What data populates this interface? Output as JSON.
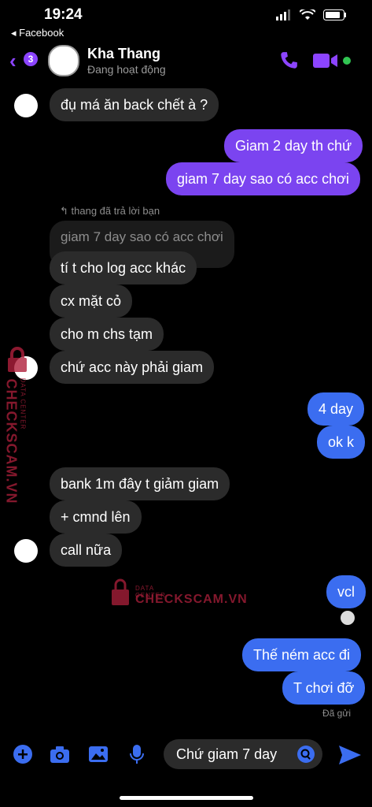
{
  "status_bar": {
    "time": "19:24",
    "back_app": "◂ Facebook"
  },
  "header": {
    "unread_count": "3",
    "contact_name": "Kha Thang",
    "contact_status": "Đang hoạt động"
  },
  "messages": [
    {
      "side": "in",
      "text": "đụ má ăn back chết  à ?"
    },
    {
      "side": "out",
      "text": "Giam 2 day th chứ"
    },
    {
      "side": "out",
      "text": "giam 7 day sao có acc chơi"
    },
    {
      "side": "in",
      "reply_label": "thang đã trả lời bạn",
      "quote": "giam 7 day sao có acc chơi"
    },
    {
      "side": "in",
      "text": "tí t cho log acc khác"
    },
    {
      "side": "in",
      "text": "cx mặt cỏ"
    },
    {
      "side": "in",
      "text": "cho m chs tạm"
    },
    {
      "side": "in",
      "text": "chứ acc này phải giam"
    },
    {
      "side": "out",
      "text": "4 day"
    },
    {
      "side": "out",
      "text": "ok k"
    },
    {
      "side": "in",
      "text": "bank 1m đây t giảm giam"
    },
    {
      "side": "in",
      "text": "+ cmnd lên"
    },
    {
      "side": "in",
      "text": "call nữa"
    },
    {
      "side": "out",
      "text": "vcl"
    },
    {
      "side": "out",
      "text": "Thế ném acc đi"
    },
    {
      "side": "out",
      "text": "T chơi đỡ"
    }
  ],
  "sent_status": "Đã gửi",
  "composer": {
    "input_value": "Chứ giam 7 day"
  },
  "watermark": {
    "brand": "CHECKSCAM.VN",
    "tagline": "DATA CENTER"
  },
  "colors": {
    "accent": "#8c44ff",
    "outgoing_purple": "#7b44f0",
    "outgoing_blue": "#3b6df0",
    "incoming": "#2b2b2b"
  }
}
